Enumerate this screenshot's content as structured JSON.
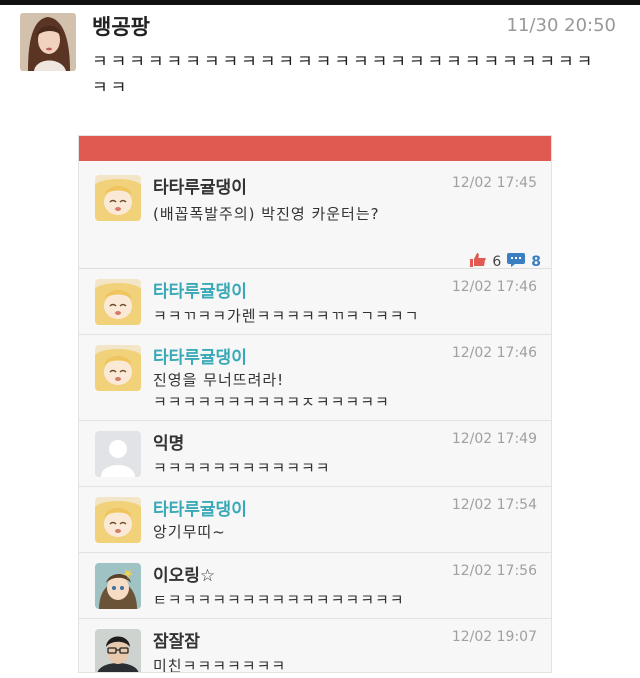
{
  "post": {
    "author": "뱅공팡",
    "timestamp": "11/30 20:50",
    "text": "ㅋㅋㅋㅋㅋㅋㅋㅋㅋㅋㅋㅋㅋㅋㅋㅋㅋㅋㅋㅋㅋㅋㅋㅋㅋㅋㅋㅋㅋ"
  },
  "card": {
    "accent_color": "#e05a52",
    "main": {
      "author": "타타루귤댕이",
      "time": "12/02 17:45",
      "text": "(배꼽폭발주의) 박진영 카운터는?",
      "likes": "6",
      "comments": "8"
    },
    "comments": [
      {
        "author": "타타루귤댕이",
        "time": "12/02 17:46",
        "lines": [
          "ㅋㅋㄲㅋㅋ가렌ㅋㅋㅋㅋㅋㄲㅋㄱㅋㅋㄱ"
        ]
      },
      {
        "author": "타타루귤댕이",
        "time": "12/02 17:46",
        "lines": [
          "진영을 무너뜨려라!",
          "ㅋㅋㅋㅋㅋㅋㅋㅋㅋㅋㅈㅋㅋㅋㅋㅋ"
        ]
      },
      {
        "author": "익명",
        "time": "12/02 17:49",
        "lines": [
          "ㅋㅋㅋㅋㅋㅋㅋㅋㅋㅋㅋㅋ"
        ]
      },
      {
        "author": "타타루귤댕이",
        "time": "12/02 17:54",
        "lines": [
          "앙기무띠~"
        ]
      },
      {
        "author": "이오링☆",
        "time": "12/02 17:56",
        "lines": [
          "ㅌㅋㅋㅋㅋㅋㅋㅋㅋㅋㅋㅋㅋㅋㅋㅋㅋ"
        ]
      },
      {
        "author": "잠잘잠",
        "time": "12/02 19:07",
        "lines": [
          "미친ㅋㅋㅋㅋㅋㅋㅋ"
        ]
      }
    ]
  }
}
